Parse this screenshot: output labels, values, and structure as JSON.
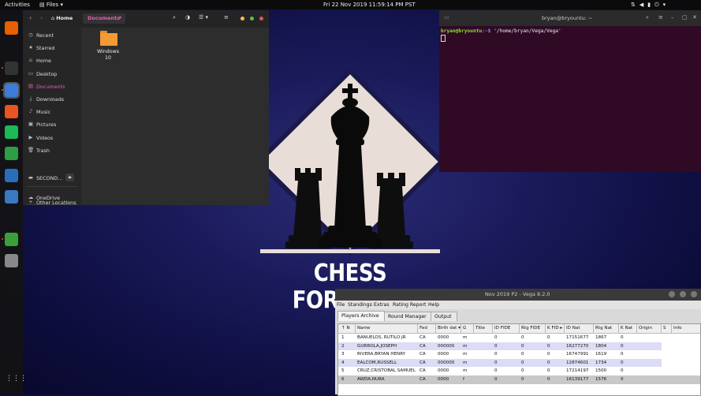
{
  "topbar": {
    "activities": "Activities",
    "app_menu": "Files",
    "clock": "Fri 22 Nov 2019 11:59:14 PM PST"
  },
  "dock": {
    "items": [
      {
        "name": "firefox-icon",
        "color": "#e66000"
      },
      {
        "name": "terminal-icon",
        "color": "#333333"
      },
      {
        "name": "files-icon",
        "color": "#3b7dd8"
      },
      {
        "name": "software-center-icon",
        "color": "#e95420"
      },
      {
        "name": "spotify-icon",
        "color": "#1db954"
      },
      {
        "name": "spreadsheet-icon",
        "color": "#2e9e44"
      },
      {
        "name": "writer-icon",
        "color": "#2a6ebb"
      },
      {
        "name": "system-monitor-icon",
        "color": "#3a78c2"
      },
      {
        "name": "vega-app-icon",
        "color": "#3a9e3a"
      },
      {
        "name": "usb-drive-icon",
        "color": "#888888"
      }
    ],
    "show_apps_label": "⋮⋮⋮"
  },
  "files": {
    "breadcrumb_home": "Home",
    "breadcrumb_current": "Documents",
    "sidebar": [
      {
        "label": "Recent",
        "icon": "◷",
        "active": false
      },
      {
        "label": "Starred",
        "icon": "★",
        "active": false
      },
      {
        "label": "Home",
        "icon": "⌂",
        "active": false
      },
      {
        "label": "Desktop",
        "icon": "▭",
        "active": false
      },
      {
        "label": "Documents",
        "icon": "▤",
        "active": true
      },
      {
        "label": "Downloads",
        "icon": "⤓",
        "active": false
      },
      {
        "label": "Music",
        "icon": "♪",
        "active": false
      },
      {
        "label": "Pictures",
        "icon": "▣",
        "active": false
      },
      {
        "label": "Videos",
        "icon": "▶",
        "active": false
      },
      {
        "label": "Trash",
        "icon": "🗑",
        "active": false
      }
    ],
    "drive_label": "SECOND...",
    "onedrive_label": "OneDrive",
    "other_locations_label": "Other Locations",
    "folder": {
      "line1": "Windows",
      "line2": "10"
    }
  },
  "wallpaper": {
    "title": "CHESS FORTRESS",
    "accent": "#ffffff"
  },
  "terminal": {
    "title": "bryan@bryountu: ~",
    "prompt_user": "bryan@bryountu",
    "prompt_path": ":~$ ",
    "command": "'/home/bryan/Vega/Vega'"
  },
  "vega": {
    "title": "Nov 2019 P2 - Vega 8.2.0",
    "menu": [
      "File",
      "Standings",
      "Extras",
      "Rating Report",
      "Help"
    ],
    "tabs": [
      "Players Archive",
      "Round Manager",
      "Output"
    ],
    "columns": [
      "↑ N",
      "Name",
      "Fed",
      "Birth dat ▾",
      "G",
      "Title",
      "ID FIDE",
      "Rtg FIDE",
      "K FID ▸",
      "ID Nat",
      "Rtg Nat",
      "K Nat",
      "Origin",
      "S",
      "Info"
    ],
    "rows": [
      [
        "1",
        "BANUELOS, RUTILO JR",
        "CA",
        "0000",
        "m",
        "",
        "0",
        "0",
        "0",
        "17151677",
        "1867",
        "0",
        "",
        "",
        ""
      ],
      [
        "2",
        "GURROLA,JOSEPH",
        "CA",
        "000000",
        "m",
        "",
        "0",
        "0",
        "0",
        "16277270",
        "1804",
        "0",
        "",
        "",
        ""
      ],
      [
        "3",
        "RIVERA,BRYAN HENRY",
        "CA",
        "0000",
        "m",
        "",
        "0",
        "0",
        "0",
        "16747991",
        "1619",
        "0",
        "",
        "",
        ""
      ],
      [
        "4",
        "EALCOM,RUSSELL",
        "CA",
        "000000",
        "m",
        "",
        "0",
        "0",
        "0",
        "12874601",
        "1734",
        "0",
        "",
        "",
        ""
      ],
      [
        "5",
        "CRUZ,CRISTOBAL SAMUEL",
        "CA",
        "0000",
        "m",
        "",
        "0",
        "0",
        "0",
        "17214197",
        "1500",
        "0",
        "",
        "",
        ""
      ],
      [
        "6",
        "AWDA,NURA",
        "CA",
        "0000",
        "f",
        "",
        "0",
        "0",
        "0",
        "16139177",
        "1576",
        "0",
        "",
        "",
        ""
      ]
    ]
  }
}
